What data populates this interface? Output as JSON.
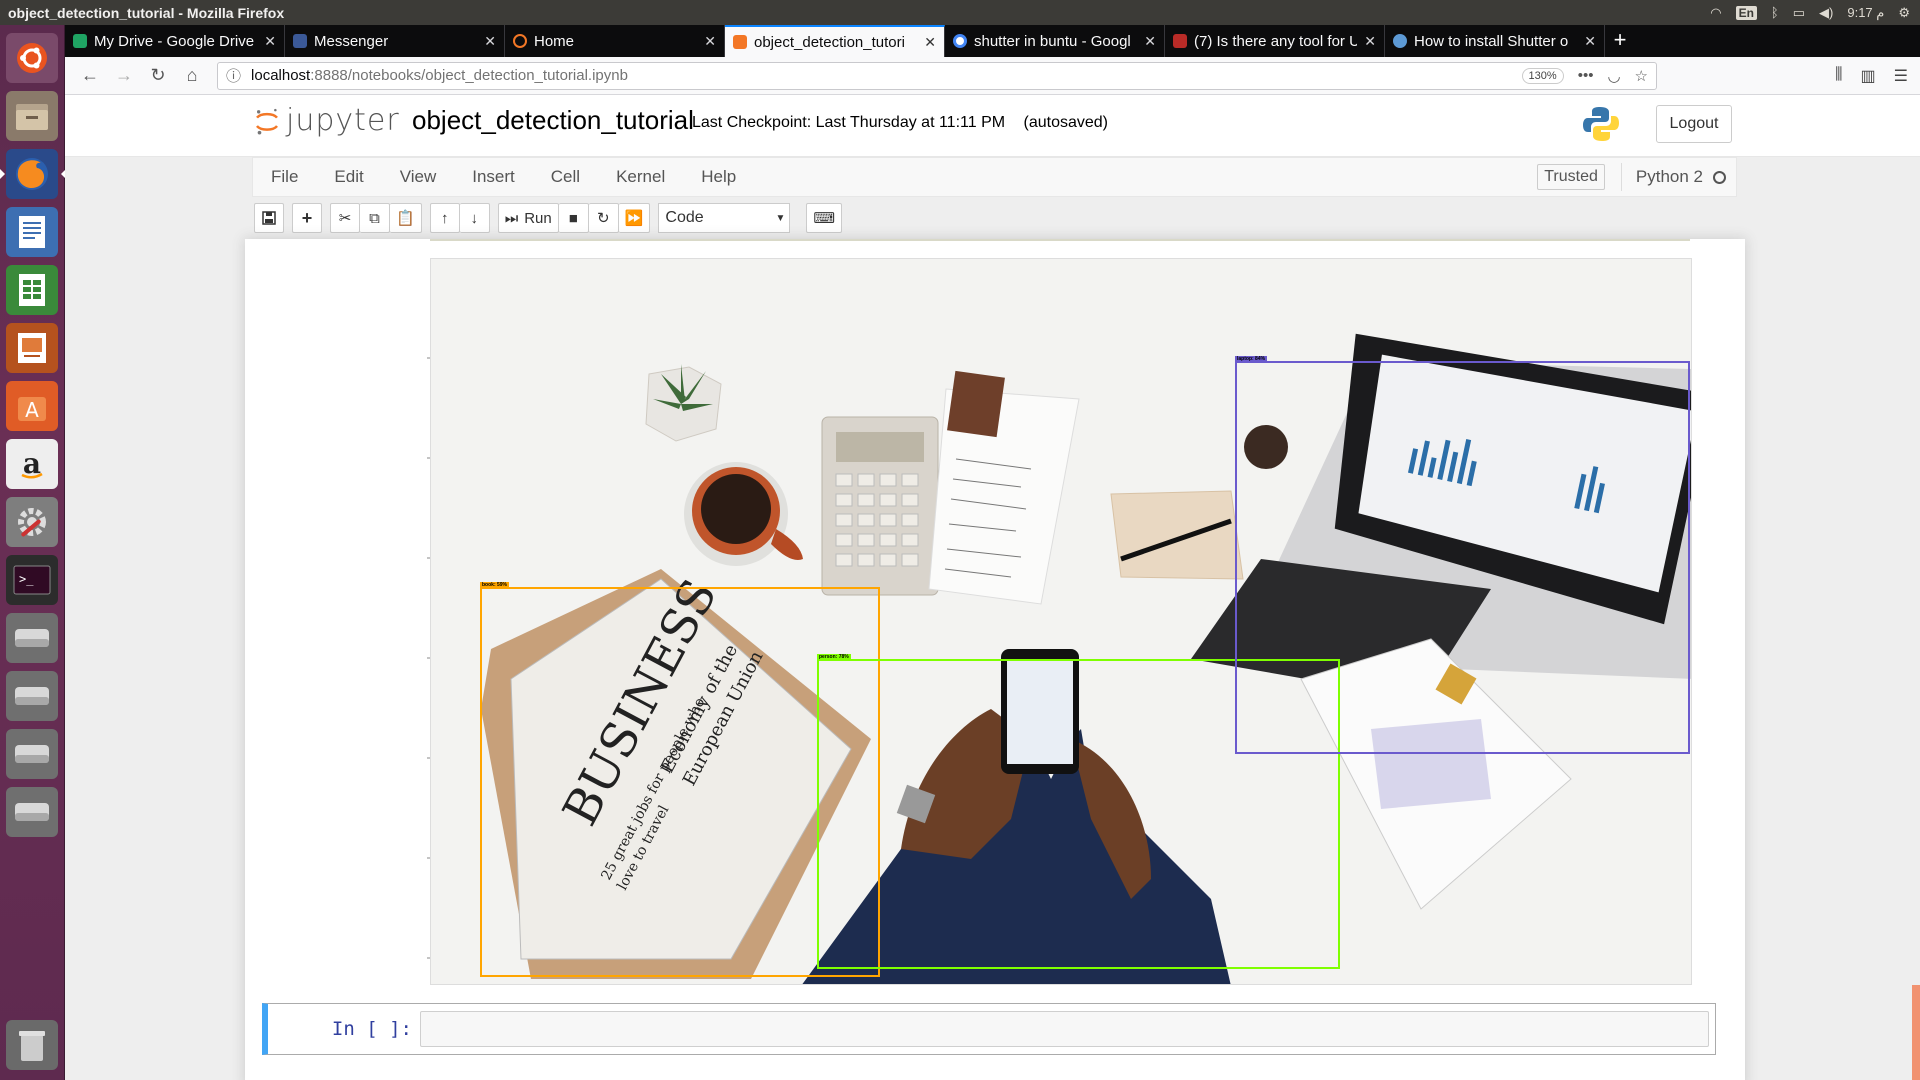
{
  "os": {
    "window_title": "object_detection_tutorial - Mozilla Firefox",
    "lang": "En",
    "clock": "م 9:17"
  },
  "tabs": [
    {
      "label": "My Drive - Google Drive",
      "icon": "google-drive-icon",
      "color": "#1fa463"
    },
    {
      "label": "Messenger",
      "icon": "facebook-icon",
      "color": "#3b5998"
    },
    {
      "label": "Home",
      "icon": "jupyter-icon",
      "color": "#f37726"
    },
    {
      "label": "object_detection_tutori",
      "icon": "jupyter-icon",
      "color": "#f37726"
    },
    {
      "label": "shutter in buntu - Googl",
      "icon": "google-icon",
      "color": "#4285f4"
    },
    {
      "label": "(7) Is there any tool for U",
      "icon": "quora-icon",
      "color": "#b92b27"
    },
    {
      "label": "How to install Shutter o",
      "icon": "askubuntu-icon",
      "color": "#5d9ad6"
    }
  ],
  "url": {
    "host": "localhost",
    "path": ":8888/notebooks/object_detection_tutorial.ipynb",
    "zoom": "130%"
  },
  "jupyter": {
    "logo_text": "jupyter",
    "notebook_name": "object_detection_tutorial",
    "checkpoint": "Last Checkpoint: Last Thursday at 11:11 PM",
    "autosaved": "(autosaved)",
    "logout": "Logout",
    "menu": [
      "File",
      "Edit",
      "View",
      "Insert",
      "Cell",
      "Kernel",
      "Help"
    ],
    "trusted": "Trusted",
    "kernel": "Python 2",
    "run_label": "Run",
    "cell_type": "Code",
    "prompt": "In [ ]:"
  },
  "detections": [
    {
      "label": "book: 59%",
      "color": "#ffa500"
    },
    {
      "label": "person: 78%",
      "color": "#7fff00"
    },
    {
      "label": "laptop: 84%",
      "color": "#6a5acd"
    }
  ]
}
